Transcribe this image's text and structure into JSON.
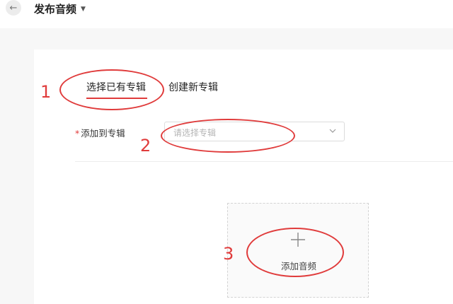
{
  "header": {
    "back_icon": "arrow-left-icon",
    "title": "发布音频",
    "title_caret_icon": "caret-down-icon"
  },
  "tabs": [
    {
      "label": "选择已有专辑",
      "active": true
    },
    {
      "label": "创建新专辑",
      "active": false
    }
  ],
  "form": {
    "required_mark": "*",
    "album_label": "添加到专辑",
    "album_select": {
      "placeholder": "请选择专辑",
      "icon": "chevron-down-icon"
    }
  },
  "upload": {
    "icon": "plus-icon",
    "label": "添加音频"
  },
  "annotations": {
    "color": "#e03b3b",
    "markers": [
      "1",
      "2",
      "3"
    ]
  },
  "colors": {
    "accent": "#e03b3b",
    "background": "#f7f7f7",
    "card": "#ffffff"
  }
}
